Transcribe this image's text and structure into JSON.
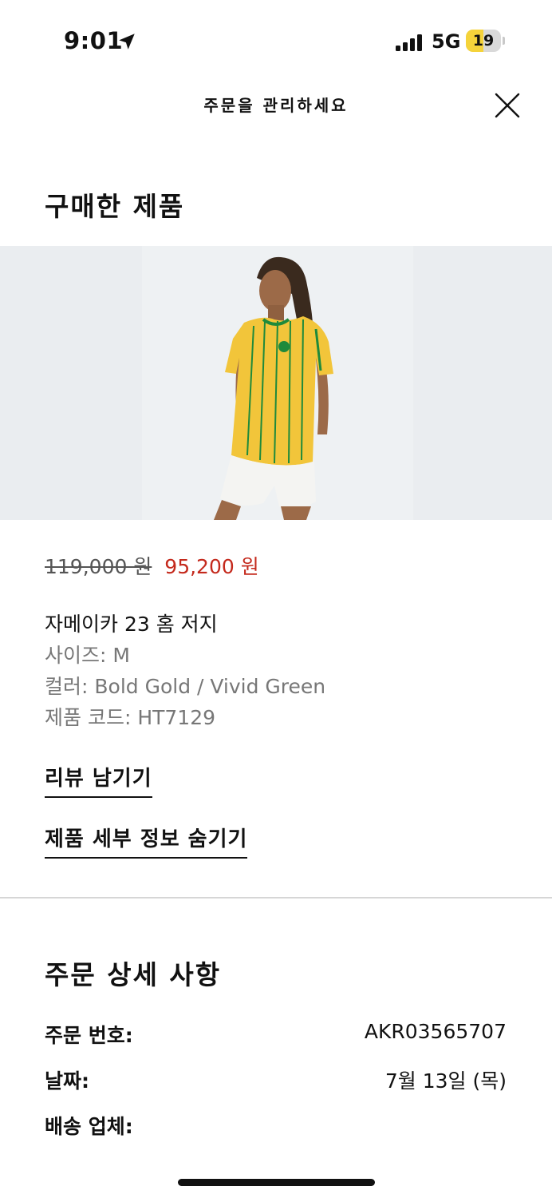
{
  "status_bar": {
    "time": "9:01",
    "network": "5G",
    "battery": "19"
  },
  "header": {
    "title": "주문을 관리하세요",
    "close_icon": "close-icon"
  },
  "purchased": {
    "section_title": "구매한 제품",
    "image_alt": "Jamaica 23 home jersey product photo",
    "price_original": "119,000 원",
    "price_sale": "95,200 원",
    "product_name": "자메이카 23 홈 저지",
    "size": "사이즈: M",
    "color": "컬러: Bold Gold / Vivid Green",
    "product_code": "제품 코드: HT7129",
    "review_link": "리뷰 남기기",
    "hide_details_link": "제품 세부 정보 숨기기"
  },
  "order_details": {
    "section_title": "주문 상세 사항",
    "rows": [
      {
        "label": "주문 번호:",
        "value": "AKR03565707"
      },
      {
        "label": "날짜:",
        "value": "7월 13일 (목)"
      },
      {
        "label": "배송 업체:",
        "value": ""
      }
    ]
  },
  "colors": {
    "sale_price": "#c4291c",
    "jersey_yellow": "#f2c53a",
    "jersey_green": "#1f8a3b"
  }
}
